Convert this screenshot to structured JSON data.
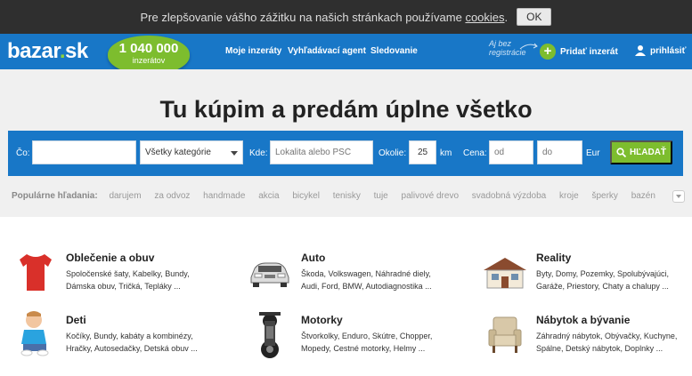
{
  "cookie": {
    "text": "Pre zlepšovanie vášho zážitku na našich stránkach používame",
    "link": "cookies",
    "suffix": ".",
    "ok_label": "OK"
  },
  "header": {
    "logo_main": "bazar",
    "logo_dot": ".",
    "logo_tld": "sk",
    "counter_number": "1 040 000",
    "counter_label": "inzerátov",
    "nav": [
      "Moje inzeráty",
      "Vyhľadávací agent",
      "Sledovanie"
    ],
    "ajbez_line1": "Aj bez",
    "ajbez_line2": "registrácie",
    "add_ad_label": "Pridať inzerát",
    "login_label": "prihlásiť"
  },
  "search": {
    "headline_pre": "Tu ",
    "headline_b1": "kúpim",
    "headline_mid": " a ",
    "headline_b2": "predám",
    "headline_post": " úplne všetko",
    "co_label": "Čo:",
    "category_value": "Všetky kategórie",
    "kde_label": "Kde:",
    "kde_placeholder": "Lokalita alebo PSČ",
    "okolie_label": "Okolie:",
    "okolie_value": "25",
    "km_label": "km",
    "cena_label": "Cena:",
    "od_placeholder": "od",
    "do_placeholder": "do",
    "eur_label": "Eur",
    "button_label": "HĽADAŤ"
  },
  "popular": {
    "label": "Populárne hľadania:",
    "tags": [
      "darujem",
      "za odvoz",
      "handmade",
      "akcia",
      "bicykel",
      "tenisky",
      "tuje",
      "palivové drevo",
      "svadobná výzdoba",
      "kroje",
      "šperky",
      "bazén"
    ]
  },
  "categories": [
    {
      "title": "Oblečenie a obuv",
      "line1": "Spoločenské šaty, Kabelky, Bundy,",
      "line2": "Dámska obuv, Tričká, Tepláky ..."
    },
    {
      "title": "Auto",
      "line1": "Škoda, Volkswagen, Náhradné diely,",
      "line2": "Audi, Ford, BMW, Autodiagnostika ..."
    },
    {
      "title": "Reality",
      "line1": "Byty, Domy, Pozemky, Spolubývajúci,",
      "line2": "Garáže, Priestory, Chaty a chalupy ..."
    },
    {
      "title": "Deti",
      "line1": "Kočíky, Bundy, kabáty a kombinézy,",
      "line2": "Hračky, Autosedačky, Detská obuv ..."
    },
    {
      "title": "Motorky",
      "line1": "Štvorkolky, Enduro, Skútre, Chopper,",
      "line2": "Mopedy, Cestné motorky, Helmy ..."
    },
    {
      "title": "Nábytok a bývanie",
      "line1": "Záhradný nábytok, Obývačky, Kuchyne,",
      "line2": "Spálne, Detský nábytok, Doplnky ..."
    }
  ],
  "colors": {
    "header_blue": "#1877c7",
    "accent_green": "#7dbd2e",
    "cookie_bg": "#2f2f2f"
  }
}
